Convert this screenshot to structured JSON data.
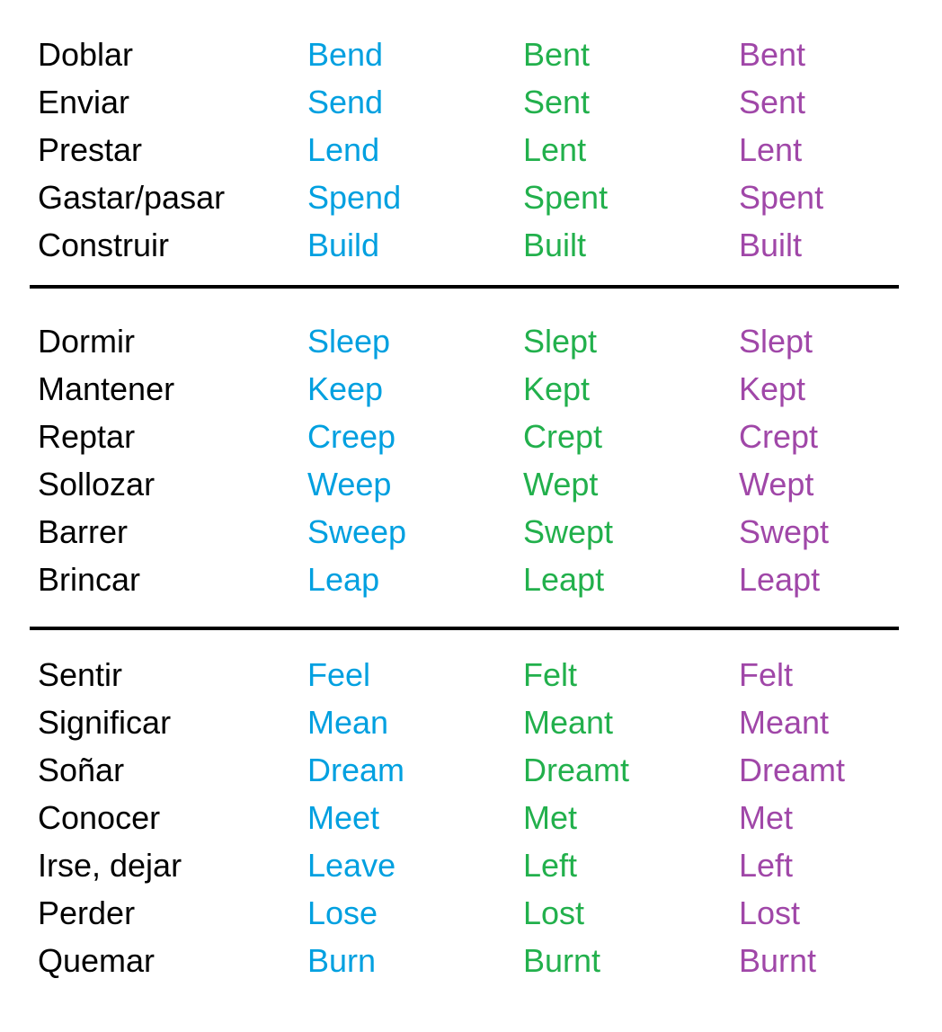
{
  "colors": {
    "spanish": "#000000",
    "base": "#00a0e0",
    "past": "#22b04c",
    "participle": "#a047a8",
    "divider": "#000000"
  },
  "groups": [
    [
      {
        "spanish": "Doblar",
        "base": "Bend",
        "past": "Bent",
        "participle": "Bent"
      },
      {
        "spanish": "Enviar",
        "base": "Send",
        "past": "Sent",
        "participle": "Sent"
      },
      {
        "spanish": "Prestar",
        "base": "Lend",
        "past": "Lent",
        "participle": "Lent"
      },
      {
        "spanish": "Gastar/pasar",
        "base": "Spend",
        "past": "Spent",
        "participle": "Spent"
      },
      {
        "spanish": "Construir",
        "base": "Build",
        "past": "Built",
        "participle": "Built"
      }
    ],
    [
      {
        "spanish": "Dormir",
        "base": "Sleep",
        "past": "Slept",
        "participle": "Slept"
      },
      {
        "spanish": "Mantener",
        "base": "Keep",
        "past": "Kept",
        "participle": "Kept"
      },
      {
        "spanish": "Reptar",
        "base": "Creep",
        "past": "Crept",
        "participle": "Crept"
      },
      {
        "spanish": "Sollozar",
        "base": "Weep",
        "past": "Wept",
        "participle": "Wept"
      },
      {
        "spanish": "Barrer",
        "base": "Sweep",
        "past": "Swept",
        "participle": "Swept"
      },
      {
        "spanish": "Brincar",
        "base": "Leap",
        "past": "Leapt",
        "participle": "Leapt"
      }
    ],
    [
      {
        "spanish": "Sentir",
        "base": "Feel",
        "past": "Felt",
        "participle": "Felt"
      },
      {
        "spanish": "Significar",
        "base": "Mean",
        "past": "Meant",
        "participle": "Meant"
      },
      {
        "spanish": "Soñar",
        "base": "Dream",
        "past": "Dreamt",
        "participle": "Dreamt"
      },
      {
        "spanish": "Conocer",
        "base": "Meet",
        "past": "Met",
        "participle": "Met"
      },
      {
        "spanish": "Irse, dejar",
        "base": "Leave",
        "past": "Left",
        "participle": "Left"
      },
      {
        "spanish": "Perder",
        "base": "Lose",
        "past": "Lost",
        "participle": "Lost"
      },
      {
        "spanish": "Quemar",
        "base": "Burn",
        "past": "Burnt",
        "participle": "Burnt"
      }
    ]
  ]
}
